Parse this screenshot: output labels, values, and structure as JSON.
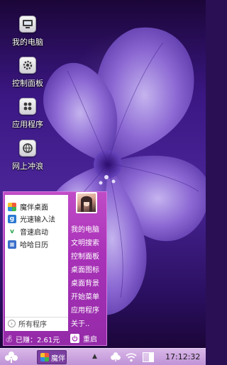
{
  "desktop": {
    "icons": [
      {
        "label": "我的电脑",
        "icon": "computer-icon"
      },
      {
        "label": "控制面板",
        "icon": "gear-icon"
      },
      {
        "label": "应用程序",
        "icon": "apps-grid-icon"
      },
      {
        "label": "网上冲浪",
        "icon": "globe-icon"
      }
    ]
  },
  "start_menu": {
    "programs": [
      {
        "label": "魔伴桌面",
        "icon": "clover-icon"
      },
      {
        "label": "光速输入法",
        "icon": "g-keyboard-icon"
      },
      {
        "label": "音速启动",
        "icon": "v-launch-icon"
      },
      {
        "label": "哈哈日历",
        "icon": "calendar-icon"
      }
    ],
    "all_programs": "所有程序",
    "right_items": [
      "我的电脑",
      "文明搜索",
      "控制面板",
      "桌面图标",
      "桌面背景",
      "开始菜单",
      "应用程序",
      "关于.."
    ],
    "earned": "已赚：2.61元",
    "restart": "重启"
  },
  "taskbar": {
    "app_label": "魔伴",
    "clock": "17:12:32",
    "battery_level": 0.4
  },
  "colors": {
    "menu_purple": "#a932b8",
    "taskbar": "#c9a3dc",
    "wallpaper": "#3b1784"
  }
}
